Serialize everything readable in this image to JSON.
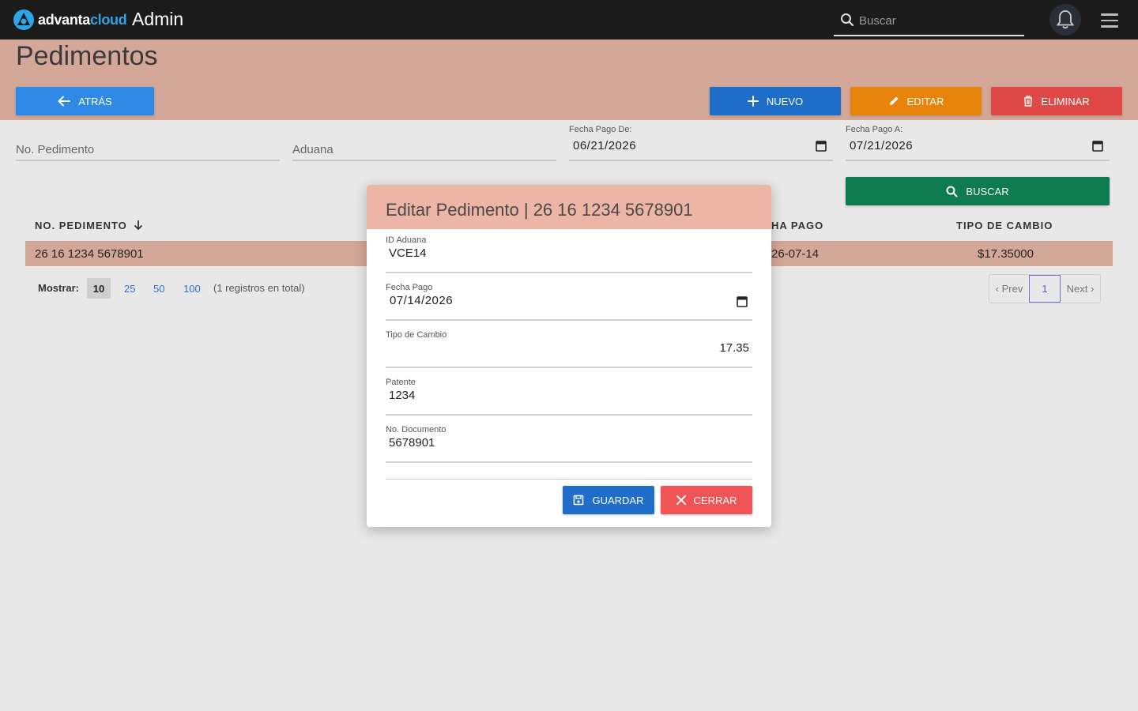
{
  "topbar": {
    "brand_part1": "advanta",
    "brand_part2": "cloud",
    "app_title": "Admin",
    "search_placeholder": "Buscar"
  },
  "page": {
    "title": "Pedimentos",
    "back_label": "ATRÁS",
    "new_label": "NUEVO",
    "edit_label": "EDITAR",
    "delete_label": "ELIMINAR"
  },
  "filters": {
    "pedimento_placeholder": "No. Pedimento",
    "aduana_placeholder": "Aduana",
    "fecha_de_label": "Fecha Pago De:",
    "fecha_de_value": "06/21/2026",
    "fecha_a_label": "Fecha Pago A:",
    "fecha_a_value": "07/21/2026",
    "search_label": "BUSCAR"
  },
  "table": {
    "headers": [
      "NO. PEDIMENTO",
      "HA PAGO",
      "TIPO DE CAMBIO"
    ],
    "rows": [
      {
        "pedimento": "26 16 1234 5678901",
        "fecha": "26-07-14",
        "tipo_cambio": "$17.35000"
      }
    ],
    "show_label": "Mostrar:",
    "page_sizes": [
      "10",
      "25",
      "50",
      "100"
    ],
    "total_text": "(1 registros en total)",
    "prev_label": "‹ Prev",
    "current_page": "1",
    "next_label": "Next ›"
  },
  "modal": {
    "title": "Editar Pedimento | 26 16 1234 5678901",
    "fields": [
      {
        "label": "ID Aduana",
        "value": "VCE14"
      },
      {
        "label": "Fecha Pago",
        "value": "07/14/2026"
      },
      {
        "label": "Tipo de Cambio",
        "value": "17.35"
      },
      {
        "label": "Patente",
        "value": "1234"
      },
      {
        "label": "No. Documento",
        "value": "5678901"
      }
    ],
    "save_label": "GUARDAR",
    "close_label": "CERRAR"
  },
  "colors": {
    "topbar": "#1b1b1b",
    "band": "#d4a898",
    "modal_header": "#edb5a6",
    "primary": "#1f6ec9",
    "warning": "#e8830c",
    "danger": "#e04848",
    "success": "#0d7a4f"
  }
}
